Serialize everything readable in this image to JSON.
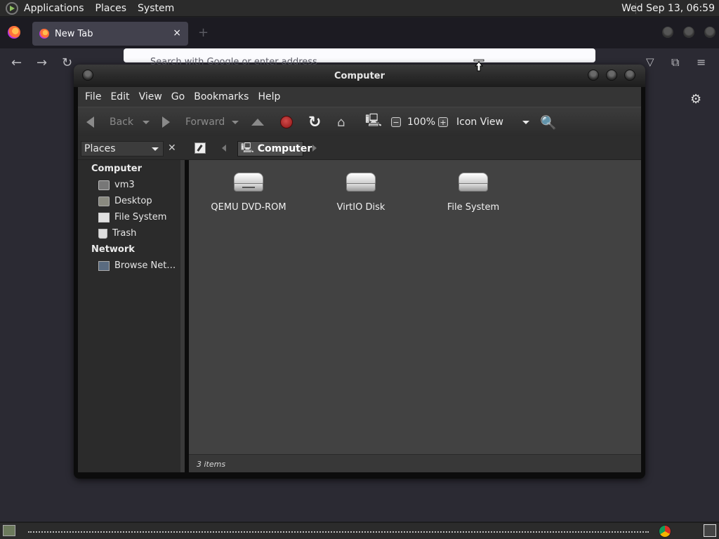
{
  "top_panel": {
    "menus": [
      "Applications",
      "Places",
      "System"
    ],
    "clock": "Wed Sep 13, 06:59"
  },
  "firefox": {
    "tab_title": "New Tab",
    "tab_close": "×",
    "new_tab": "+",
    "url_placeholder": "Search with Google or enter address"
  },
  "window": {
    "title": "Computer",
    "menubar": [
      "File",
      "Edit",
      "View",
      "Go",
      "Bookmarks",
      "Help"
    ],
    "toolbar": {
      "back": "Back",
      "forward": "Forward",
      "zoom_out": "−",
      "zoom_in": "+",
      "zoom": "100%",
      "view_mode": "Icon View"
    },
    "location": {
      "side_pane": "Places",
      "side_close": "✕",
      "crumb": "Computer"
    },
    "sidebar": {
      "computer_header": "Computer",
      "computer_items": [
        "vm3",
        "Desktop",
        "File System",
        "Trash"
      ],
      "network_header": "Network",
      "network_items": [
        "Browse Net…"
      ]
    },
    "icons": [
      "QEMU DVD-ROM",
      "VirtIO Disk",
      "File System"
    ],
    "status": "3 items"
  },
  "colors": {
    "panel": "#2b2b2b",
    "firefox_bg": "#2b2a33",
    "window_content": "#424242",
    "stop_red": "#c0392b"
  }
}
